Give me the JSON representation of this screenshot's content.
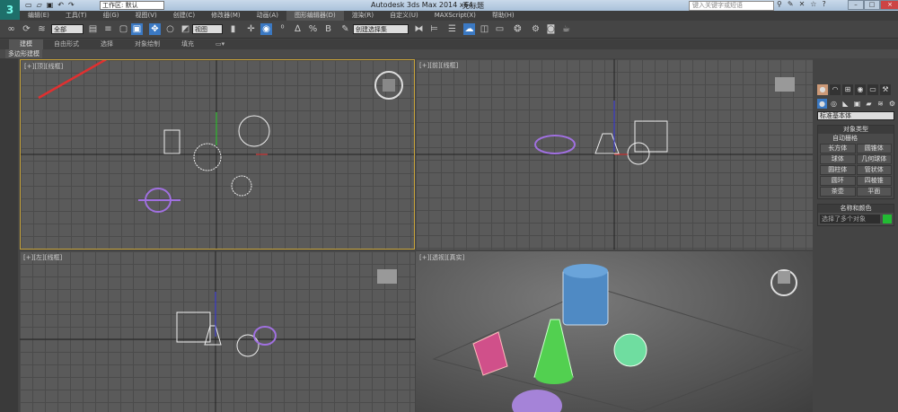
{
  "titlebar": {
    "workspace": "工作区: 默认",
    "app_title": "Autodesk 3ds Max  2014 x64",
    "doc_title": "无标题",
    "search_placeholder": "键入关键字或短语"
  },
  "menu": [
    "编辑(E)",
    "工具(T)",
    "组(G)",
    "视图(V)",
    "创建(C)",
    "修改器(M)",
    "动画(A)",
    "图形编辑器(D)",
    "渲染(R)",
    "自定义(U)",
    "MAXScript(X)",
    "帮助(H)"
  ],
  "toolbar": {
    "selection_filter": "全部",
    "ref_coord": "视图",
    "named_selection": "创建选择集"
  },
  "ribbon": {
    "tabs": [
      "建模",
      "自由形式",
      "选择",
      "对象绘制",
      "填充"
    ],
    "panel_label": "多边形建模"
  },
  "viewports": [
    {
      "label": "[+][顶][线框]",
      "active": true
    },
    {
      "label": "[+][前][线框]"
    },
    {
      "label": "[+][左][线框]"
    },
    {
      "label": "[+][透视][真实]"
    }
  ],
  "command_panel": {
    "category": "标准基本体",
    "object_type_title": "对象类型",
    "autogrid": "自动栅格",
    "buttons": [
      "长方体",
      "圆锥体",
      "球体",
      "几何球体",
      "圆柱体",
      "管状体",
      "圆环",
      "四棱锥",
      "茶壶",
      "平面"
    ],
    "name_color_title": "名称和颜色",
    "name_value": "选择了多个对象",
    "object_color": "#22bb33"
  },
  "colors": {
    "accent": "#3b79c3",
    "active_border": "#c8a43a",
    "annotation_arrow": "#e03030"
  }
}
